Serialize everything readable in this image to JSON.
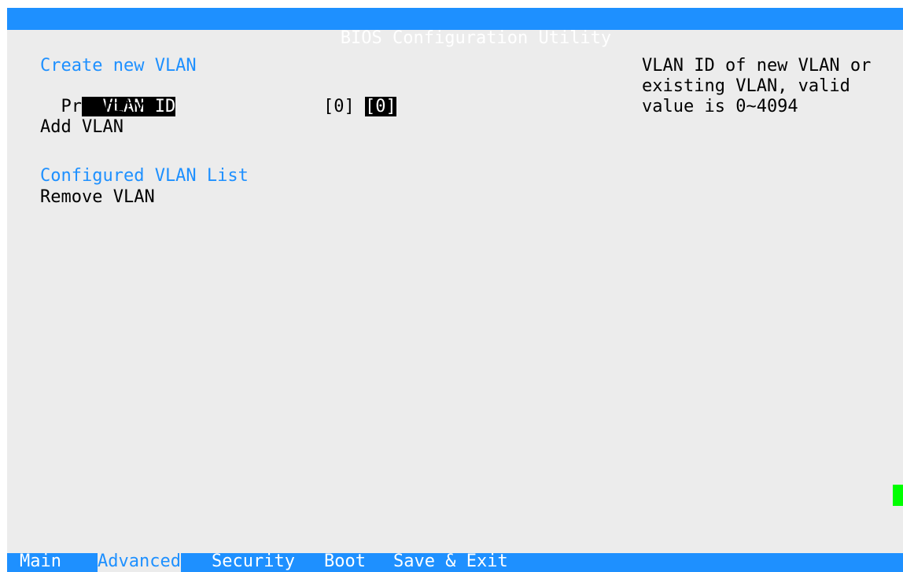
{
  "window": {
    "title": "BIOS Configuration Utility"
  },
  "main": {
    "create_section": {
      "heading": "Create new VLAN",
      "fields": [
        {
          "label": "VLAN ID",
          "value": "[0]"
        },
        {
          "label": "Priority",
          "value": "[0]"
        }
      ],
      "add_action": "Add VLAN"
    },
    "configured_section": {
      "heading": "Configured VLAN List",
      "remove_action": "Remove VLAN"
    }
  },
  "help": {
    "lines": [
      "VLAN ID of new VLAN or",
      "existing VLAN, valid",
      "value is 0~4094"
    ]
  },
  "menu": {
    "items": [
      "Main",
      "Advanced",
      "Security",
      "Boot",
      "Save & Exit"
    ],
    "active": "Advanced"
  },
  "colors": {
    "title_bar": "#1e90ff",
    "background": "#ececec",
    "highlight": "#000000",
    "scroll_indicator": "#00ff00"
  }
}
